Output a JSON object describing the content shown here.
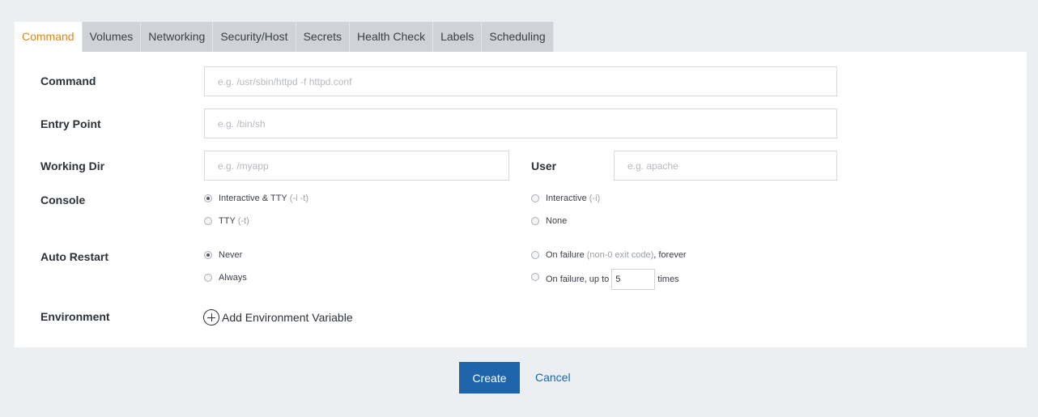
{
  "tabs": [
    {
      "label": "Command",
      "active": true
    },
    {
      "label": "Volumes"
    },
    {
      "label": "Networking"
    },
    {
      "label": "Security/Host"
    },
    {
      "label": "Secrets"
    },
    {
      "label": "Health Check"
    },
    {
      "label": "Labels"
    },
    {
      "label": "Scheduling"
    }
  ],
  "form": {
    "command": {
      "label": "Command",
      "placeholder": "e.g. /usr/sbin/httpd -f httpd.conf",
      "value": ""
    },
    "entry_point": {
      "label": "Entry Point",
      "placeholder": "e.g. /bin/sh",
      "value": ""
    },
    "working_dir": {
      "label": "Working Dir",
      "placeholder": "e.g. /myapp",
      "value": ""
    },
    "user": {
      "label": "User",
      "placeholder": "e.g. apache",
      "value": ""
    },
    "console": {
      "label": "Console",
      "options": [
        {
          "label": "Interactive & TTY",
          "hint": "(-i -t)",
          "checked": true
        },
        {
          "label": "Interactive",
          "hint": "(-i)",
          "checked": false
        },
        {
          "label": "TTY",
          "hint": "(-t)",
          "checked": false
        },
        {
          "label": "None",
          "hint": "",
          "checked": false
        }
      ]
    },
    "auto_restart": {
      "label": "Auto Restart",
      "never": "Never",
      "always": "Always",
      "on_failure_forever": {
        "label": "On failure",
        "hint": "(non-0 exit code)",
        "suffix": ", forever"
      },
      "on_failure_upto": {
        "label": "On failure, up to",
        "value": "5",
        "suffix": "times"
      }
    },
    "environment": {
      "label": "Environment",
      "add_label": "Add Environment Variable"
    }
  },
  "actions": {
    "create": "Create",
    "cancel": "Cancel"
  }
}
